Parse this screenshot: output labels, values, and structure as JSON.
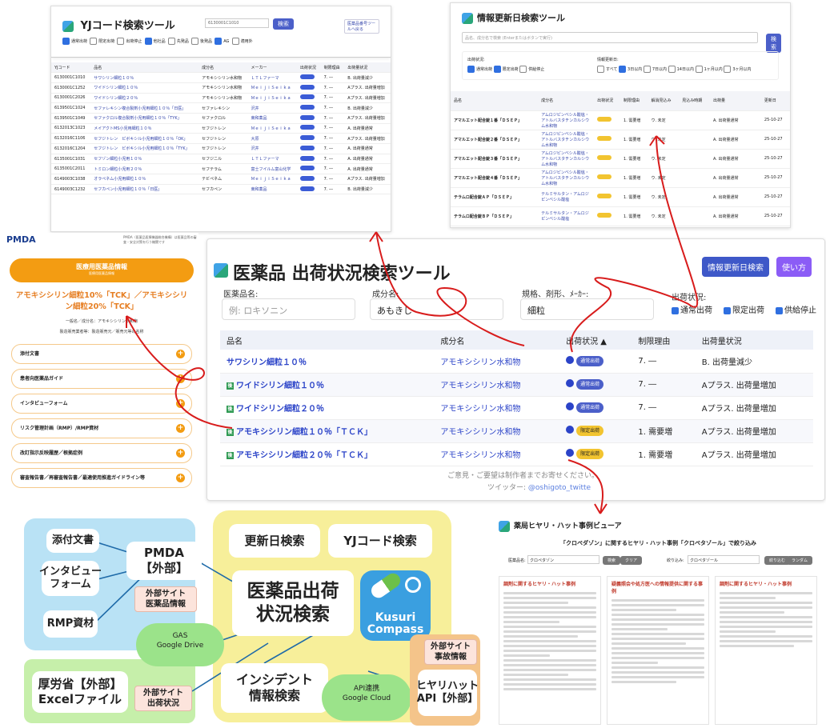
{
  "yj": {
    "title": "YJコード検索ツール",
    "search_value": "6130001C1010",
    "search_btn": "検索",
    "switch_btn": "医薬品番号ツールへ戻る",
    "filters": [
      "通常出荷",
      "限定出荷",
      "出荷停止",
      "他社品",
      "先発品",
      "後発品",
      "AG",
      "適用外"
    ],
    "headers": [
      "YJコード",
      "品名",
      "成分名",
      "メーカー",
      "出荷状況",
      "制限理由",
      "出荷量状況"
    ],
    "rows": [
      [
        "6130001C1010",
        "サワシリン細粒１０％",
        "アモキシシリン水和物",
        "ＬＴＬファーマ",
        "7. ―",
        "B. 出荷量減少"
      ],
      [
        "6130001C1252",
        "ワイドシリン細粒１０％",
        "アモキシシリン水和物",
        "ＭｅｉｊｉＳｅｉｋａ",
        "7. ―",
        "Aプラス. 出荷量増加"
      ],
      [
        "6130001C2026",
        "ワイドシリン細粒２０％",
        "アモキシシリン水和物",
        "ＭｅｉｊｉＳｅｉｋａ",
        "7. ―",
        "Aプラス. 出荷量増加"
      ],
      [
        "6139501C1024",
        "セファレキシン複合製剤小児用細粒１０％「日医」",
        "セファレキシン",
        "沢井",
        "7. ―",
        "B. 出荷量減少"
      ],
      [
        "6139501C1049",
        "セファクロル複合製剤小児用細粒１０％「TYK」",
        "セファクロル",
        "東和薬品",
        "7. ―",
        "Aプラス. 出荷量増加"
      ],
      [
        "6132013C1023",
        "メイアクトMS小児用細粒１０％",
        "セフジトレン",
        "ＭｅｉｊｉＳｅｉｋａ",
        "7. ―",
        "A. 出荷量通常"
      ],
      [
        "6132016C1106",
        "セフジトレン　ピボキシル小児用細粒１０％「OK」",
        "セフジトレン",
        "大原",
        "7. ―",
        "Aプラス. 出荷量増加"
      ],
      [
        "6132016C1204",
        "セフジトレン　ピボキシル小児用細粒１０％「TYK」",
        "セフジトレン",
        "沢井",
        "7. ―",
        "A. 出荷量通常"
      ],
      [
        "6135001C1031",
        "セフゾン細粒小児用１０％",
        "セフジニル",
        "ＬＴＬファーマ",
        "7. ―",
        "A. 出荷量通常"
      ],
      [
        "6135001C2011",
        "トミロン細粒小児用２０％",
        "セフテラム",
        "富士フイルム富山化学",
        "7. ―",
        "A. 出荷量通常"
      ],
      [
        "6149003C1038",
        "オラペネム小児用細粒１０％",
        "テビペネム",
        "ＭｅｉｊｉＳｅｉｋａ",
        "7. ―",
        "Aプラス. 出荷量増加"
      ],
      [
        "6149003C1232",
        "セフカペン小児用細粒１０％「日医」",
        "セフカペン",
        "東和薬品",
        "7. ―",
        "B. 出荷量減少"
      ]
    ]
  },
  "jk": {
    "title": "情報更新日検索ツール",
    "search_placeholder": "品名、成分名で検索 (Enterまたはボタンで実行)",
    "search_btn": "検索",
    "status_label": "出荷状況:",
    "status_opts": [
      "通常出荷",
      "限定出荷",
      "供給停止"
    ],
    "date_label": "情報更新日:",
    "date_opts": [
      "すべて",
      "3日以内",
      "7日以内",
      "14日以内",
      "1ヶ月以内",
      "3ヶ月以内"
    ],
    "headers": [
      "品名",
      "成分名",
      "出荷状況",
      "制限理由",
      "解消見込み",
      "見込み時期",
      "出荷量",
      "更新日"
    ],
    "rows": [
      [
        "アマルエット配合錠１番「ＤＳＥＰ」",
        "アムロジピンベシル酸塩・アトルバスタチンカルシウム水和物",
        "1. 需要増",
        "ウ. 未定",
        "A. 出荷量通常",
        "25-10-27"
      ],
      [
        "アマルエット配合錠２番「ＤＳＥＰ」",
        "アムロジピンベシル酸塩・アトルバスタチンカルシウム水和物",
        "1. 需要増",
        "ウ. 未定",
        "A. 出荷量通常",
        "25-10-27"
      ],
      [
        "アマルエット配合錠３番「ＤＳＥＰ」",
        "アムロジピンベシル酸塩・アトルバスタチンカルシウム水和物",
        "1. 需要増",
        "ウ. 未定",
        "A. 出荷量通常",
        "25-10-27"
      ],
      [
        "アマルエット配合錠４番「ＤＳＥＰ」",
        "アムロジピンベシル酸塩・アトルバスタチンカルシウム水和物",
        "1. 需要増",
        "ウ. 未定",
        "A. 出荷量通常",
        "25-10-27"
      ],
      [
        "テラムロ配合錠ＡＰ「ＤＳＥＰ」",
        "テルミサルタン・アムロジピンベシル酸塩",
        "1. 需要増",
        "ウ. 未定",
        "A. 出荷量通常",
        "25-10-27"
      ],
      [
        "テラムロ配合錠ＢＰ「ＤＳＥＰ」",
        "テルミサルタン・アムロジピンベシル酸塩",
        "1. 需要増",
        "ウ. 未定",
        "A. 出荷量通常",
        "25-10-27"
      ],
      [
        "バルサルタン錠２０ｍｇ「日医」",
        "バルサルタン",
        "7. ―",
        "",
        "Aプラス. 出荷量増加",
        "25-10-27"
      ],
      [
        "バルサルタン錠４０ｍｇ「日医」",
        "バルサルタン",
        "7. ―",
        "",
        "Aプラス. 出荷量増加",
        "25-10-27"
      ]
    ]
  },
  "main": {
    "title": "医薬品 出荷状況検索ツール",
    "btn_update": "情報更新日検索",
    "btn_help": "使い方",
    "label_drug": "医薬品名:",
    "placeholder_drug": "例: ロキソニン",
    "label_ing": "成分名:",
    "value_ing": "あもきし",
    "label_form": "規格、剤形、ﾒｰｶｰ:",
    "value_form": "細粒",
    "status_label": "出荷状況:",
    "status_opts": [
      "通常出荷",
      "限定出荷",
      "供給停止"
    ],
    "headers": [
      "品名",
      "成分名",
      "出荷状況 ▲",
      "制限理由",
      "出荷量状況"
    ],
    "rows": [
      {
        "name": "サワシリン細粒１０％",
        "gen": false,
        "ing": "アモキシシリン水和物",
        "status": "通常出荷",
        "reason": "7. ―",
        "vol": "B. 出荷量減少"
      },
      {
        "name": "ワイドシリン細粒１０％",
        "gen": true,
        "ing": "アモキシシリン水和物",
        "status": "通常出荷",
        "reason": "7. ―",
        "vol": "Aプラス. 出荷量増加"
      },
      {
        "name": "ワイドシリン細粒２０％",
        "gen": true,
        "ing": "アモキシシリン水和物",
        "status": "通常出荷",
        "reason": "7. ―",
        "vol": "Aプラス. 出荷量増加"
      },
      {
        "name": "アモキシシリン細粒１０％「ＴＣＫ」",
        "gen": true,
        "ing": "アモキシシリン水和物",
        "status": "限定出荷",
        "reason": "1. 需要増",
        "vol": "Aプラス. 出荷量増加"
      },
      {
        "name": "アモキシシリン細粒２０％「ＴＣＫ」",
        "gen": true,
        "ing": "アモキシシリン水和物",
        "status": "限定出荷",
        "reason": "1. 需要増",
        "vol": "Aプラス. 出荷量増加"
      }
    ],
    "gen_mark": "後",
    "footer1": "ご意見・ご要望は制作者までお寄せください。",
    "footer2_prefix": "ツイッター: ",
    "footer2_link": "@oshigoto_twitte"
  },
  "pmda": {
    "logo": "PMDA",
    "note": "PMDA（医薬品医療機器総合機構）は医薬品等の審査・安全対策を行う機関です",
    "banner": "医療用医薬品情報",
    "banner_sub": "医療用医薬品情報",
    "drug": "アモキシシリン細粒10%「TCK」／アモキシシリン細粒20%「TCK」",
    "ing": "一般名／成分名：アモキシシリン水和物",
    "maker": "製造販売業者等：製造販売元／販売元等の名称",
    "items": [
      "添付文書",
      "患者向医薬品ガイド",
      "インタビューフォーム",
      "リスク管理計画（RMP）/RMP資材",
      "改訂指示反映履歴／根拠症例",
      "審査報告書／再審査報告書／最適使用推進ガイドライン等"
    ]
  },
  "hy": {
    "title": "薬局ヒヤリ・ハット事例ビューア",
    "heading": "「クロペダゾン」に関するヒヤリ・ハット事例「クロペタゾール」で絞り込み",
    "label1": "医薬品名:",
    "value1": "クロペタゾン",
    "btn_search": "検索",
    "btn_clear": "クリア",
    "label2": "絞り込み:",
    "value2": "クロペタゾール",
    "btn_filter": "絞り込む",
    "btn_random": "ランダム",
    "cols": [
      "調剤に関するヒヤリ・ハット事例",
      "疑義照会や処方医への情報提供に関する事例",
      "調剤に関するヒヤリ・ハット事例"
    ]
  },
  "diagram": {
    "center": "医薬品出荷\n状況検索",
    "n_tenpu": "添付文書",
    "n_if": "インタビュー\nフォーム",
    "n_rmp": "RMP資材",
    "n_pmda": "PMDA\n【外部】",
    "t_pmda": "外部サイト\n医薬品情報",
    "n_update": "更新日検索",
    "n_yj": "YJコード検索",
    "app_name": "Kusuri\nCompass",
    "gas": "GAS\nGoogle Drive",
    "n_mhlw": "厚労省【外部】\nExcelファイル",
    "t_mhlw": "外部サイト\n出荷状況",
    "n_incident": "インシデント\n情報検索",
    "api": "API連携\nGoogle Cloud",
    "t_hy": "外部サイト\n事故情報",
    "n_hy": "ヒヤリハット\nAPI【外部】"
  },
  "colors": {
    "accent": "#4b5fc9",
    "limited": "#f2c430",
    "pmda_orange": "#f39c12",
    "arrow": "#d81c1c",
    "group_blue": "#b9e2f5",
    "group_yellow": "#f7ef9a",
    "group_green": "#c6efaa"
  }
}
